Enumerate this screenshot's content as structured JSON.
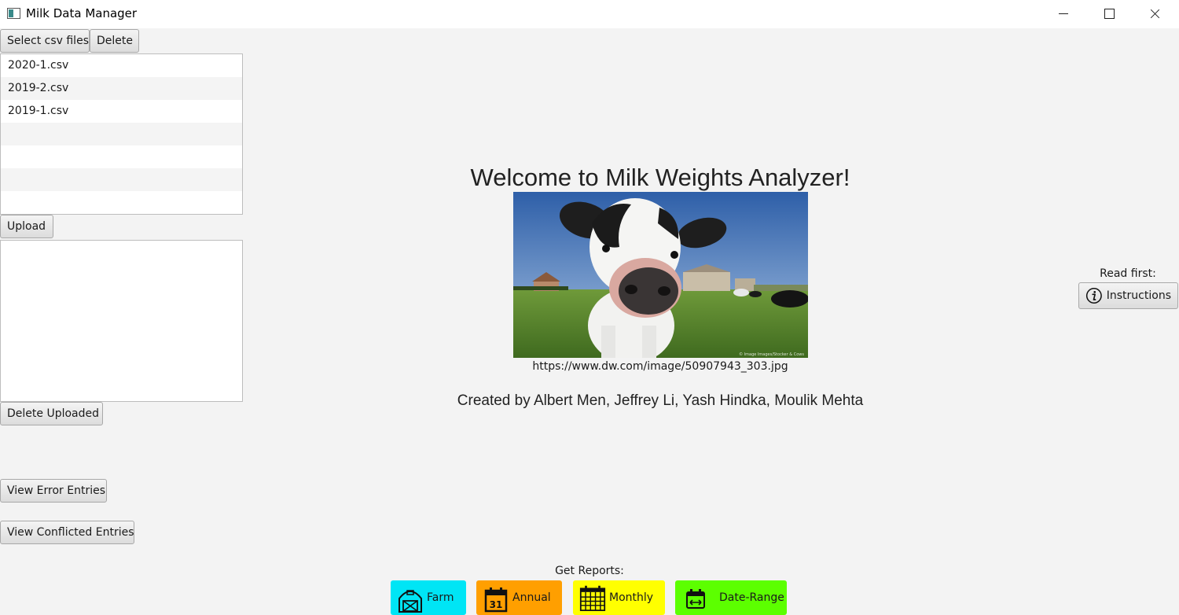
{
  "window": {
    "title": "Milk Data Manager"
  },
  "sidebar": {
    "select_files_label": "Select csv files",
    "delete_label": "Delete",
    "files": [
      "2020-1.csv",
      "2019-2.csv",
      "2019-1.csv"
    ],
    "upload_label": "Upload",
    "delete_uploaded_label": "Delete Uploaded",
    "view_errors_label": "View Error Entries",
    "view_conflicts_label": "View Conflicted Entries"
  },
  "main": {
    "welcome": "Welcome to Milk Weights Analyzer!",
    "photo_caption": "https://www.dw.com/image/50907943_303.jpg",
    "credits": "Created by Albert Men, Jeffrey Li, Yash Hindka, Moulik Mehta"
  },
  "help": {
    "read_first": "Read first:",
    "instructions_label": "Instructions",
    "icon": "info-icon"
  },
  "reports": {
    "label": "Get Reports:",
    "buttons": [
      {
        "label": "Farm",
        "icon": "barn-icon",
        "color": "#00e5f5"
      },
      {
        "label": "Annual",
        "icon": "calendar-31-icon",
        "color": "#ff9f00"
      },
      {
        "label": "Monthly",
        "icon": "calendar-grid-icon",
        "color": "#ffff00"
      },
      {
        "label": "Date-Range",
        "icon": "date-range-icon",
        "color": "#5cff00"
      }
    ]
  }
}
